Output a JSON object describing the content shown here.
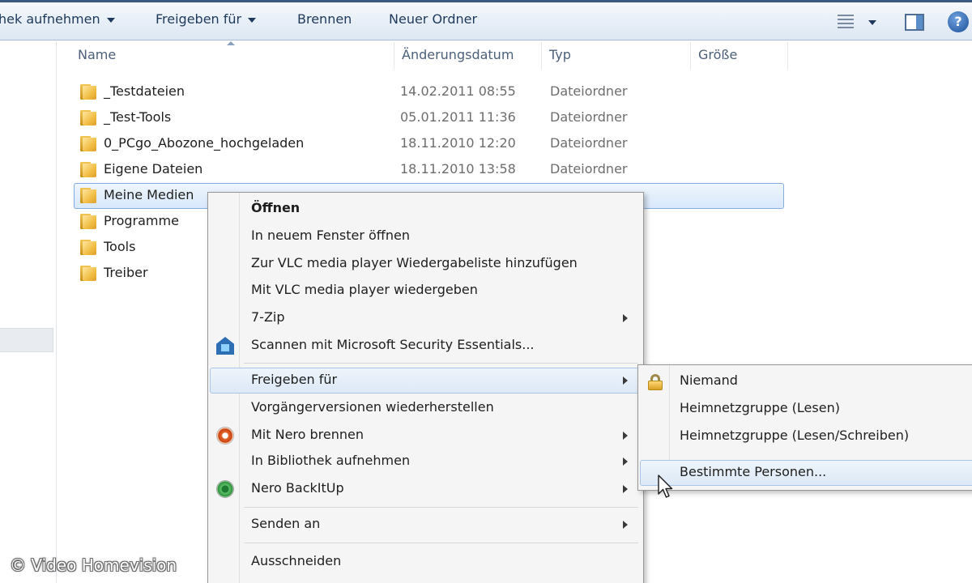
{
  "toolbar": {
    "library_label": "hek aufnehmen",
    "share_label": "Freigeben für",
    "burn_label": "Brennen",
    "new_folder_label": "Neuer Ordner",
    "views_icon": "view-list-icon",
    "preview_pane_icon": "preview-pane-icon",
    "help_icon": "help-icon",
    "help_glyph": "?"
  },
  "columns": {
    "name": "Name",
    "date": "Änderungsdatum",
    "type": "Typ",
    "size": "Größe"
  },
  "files": [
    {
      "name": "_Testdateien",
      "date": "14.02.2011 08:55",
      "type": "Dateiordner"
    },
    {
      "name": "_Test-Tools",
      "date": "05.01.2011 11:36",
      "type": "Dateiordner"
    },
    {
      "name": "0_PCgo_Abozone_hochgeladen",
      "date": "18.11.2010 12:20",
      "type": "Dateiordner"
    },
    {
      "name": "Eigene Dateien",
      "date": "18.11.2010 13:58",
      "type": "Dateiordner"
    },
    {
      "name": "Meine Medien",
      "date": "",
      "type": "",
      "selected": true
    },
    {
      "name": "Programme",
      "date": "",
      "type": ""
    },
    {
      "name": "Tools",
      "date": "",
      "type": ""
    },
    {
      "name": "Treiber",
      "date": "",
      "type": ""
    }
  ],
  "context_menu": {
    "items": [
      {
        "label": "Öffnen",
        "bold": true
      },
      {
        "label": "In neuem Fenster öffnen"
      },
      {
        "label": "Zur VLC media player Wiedergabeliste hinzufügen"
      },
      {
        "label": "Mit VLC media player wiedergeben"
      },
      {
        "label": "7-Zip",
        "submenu": true
      },
      {
        "label": "Scannen mit Microsoft Security Essentials...",
        "icon": "security-essentials-icon"
      },
      {
        "label": "Freigeben für",
        "submenu": true,
        "hover": true
      },
      {
        "label": "Vorgängerversionen wiederherstellen"
      },
      {
        "label": "Mit Nero brennen",
        "submenu": true,
        "icon": "nero-burn-icon"
      },
      {
        "label": "In Bibliothek aufnehmen",
        "submenu": true
      },
      {
        "label": "Nero BackItUp",
        "submenu": true,
        "icon": "nero-backitup-icon"
      },
      {
        "label": "Senden an",
        "submenu": true
      },
      {
        "label": "Ausschneiden"
      }
    ]
  },
  "share_submenu": {
    "items": [
      {
        "label": "Niemand",
        "icon": "lock-icon"
      },
      {
        "label": "Heimnetzgruppe (Lesen)"
      },
      {
        "label": "Heimnetzgruppe (Lesen/Schreiben)"
      },
      {
        "label": "Bestimmte Personen...",
        "hover": true
      }
    ]
  },
  "watermark": "© Video Homevision",
  "colors": {
    "selection": "#d8e8fb",
    "selection_border": "#84acdd",
    "menu_bg": "#f5f5f5",
    "toolbar_text": "#1e395b"
  }
}
